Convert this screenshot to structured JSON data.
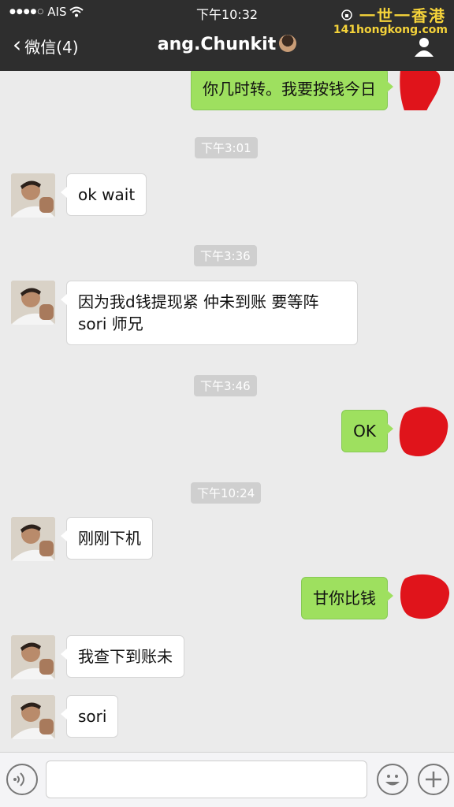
{
  "status_bar": {
    "carrier": "AIS",
    "time": "下午10:32",
    "watermark": "一世一香港"
  },
  "nav": {
    "back_label": "微信(4)",
    "title": "ang.Chunkit",
    "watermark_sub": "141hongkong.com"
  },
  "messages": [
    {
      "kind": "out",
      "text": "你几时转。我要按钱今日"
    },
    {
      "kind": "time",
      "text": "下午3:01"
    },
    {
      "kind": "in",
      "text": "ok wait"
    },
    {
      "kind": "time",
      "text": "下午3:36"
    },
    {
      "kind": "in",
      "text": "因为我d钱提现紧 仲未到账 要等阵\nsori 师兄"
    },
    {
      "kind": "time",
      "text": "下午3:46"
    },
    {
      "kind": "out",
      "text": "OK"
    },
    {
      "kind": "time",
      "text": "下午10:24"
    },
    {
      "kind": "in",
      "text": "刚刚下机"
    },
    {
      "kind": "out",
      "text": "甘你比钱"
    },
    {
      "kind": "in",
      "text": "我查下到账未"
    },
    {
      "kind": "in",
      "text": "sori"
    }
  ],
  "colors": {
    "bar_bg": "#2e2e2e",
    "chat_bg": "#ebebeb",
    "outgoing_bubble": "#9ee05f",
    "incoming_bubble": "#ffffff",
    "redaction": "#e0141b",
    "watermark": "#f5d33a"
  },
  "icons": {
    "back": "chevron-left-icon",
    "profile": "person-icon",
    "voice": "voice-icon",
    "emoji": "smiley-icon",
    "plus": "plus-icon"
  }
}
